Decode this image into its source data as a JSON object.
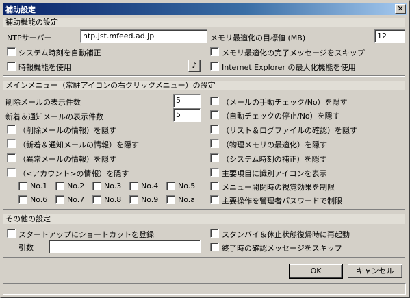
{
  "window": {
    "title": "補助設定",
    "close_glyph": "✕"
  },
  "aux": {
    "heading": "補助機能の設定",
    "ntp_label": "NTPサーバー",
    "ntp_value": "ntp.jst.mfeed.ad.jp",
    "mem_target_label": "メモリ最適化の目標値 (MB)",
    "mem_target_value": "12",
    "checks_left": [
      "システム時刻を自動補正",
      "時報機能を使用"
    ],
    "checks_right": [
      "メモリ最適化の完了メッセージをスキップ",
      "Internet Explorer の最大化機能を使用"
    ],
    "sound_glyph": "♪"
  },
  "menu": {
    "heading": "メインメニュー（常駐アイコンの右クリックメニュー）の設定",
    "del_count_label": "削除メールの表示件数",
    "del_count_value": "5",
    "new_count_label": "新着＆通知メールの表示件数",
    "new_count_value": "5",
    "checks_left": [
      "（削除メールの情報）を隠す",
      "（新着＆通知メールの情報）を隠す",
      "（異常メールの情報）を隠す",
      "（<アカウント>の情報）を隠す"
    ],
    "checks_right": [
      "（メールの手動チェック/No）を隠す",
      "（自動チェックの停止/No）を隠す",
      "（リスト＆ログファイルの確認）を隠す",
      "（物理メモリの最適化）を隠す",
      "（システム時刻の補正）を隠す",
      "主要項目に識別アイコンを表示",
      "メニュー開閉時の視覚効果を制限",
      "主要操作を管理者パスワードで制限"
    ],
    "accounts_row1": [
      "No.1",
      "No.2",
      "No.3",
      "No.4",
      "No.5"
    ],
    "accounts_row2": [
      "No.6",
      "No.7",
      "No.8",
      "No.9",
      "No.a"
    ]
  },
  "other": {
    "heading": "その他の設定",
    "startup_label": "スタートアップにショートカットを登録",
    "args_label": "引数",
    "args_value": "",
    "checks_right": [
      "スタンバイ＆休止状態復帰時に再起動",
      "終了時の確認メッセージをスキップ"
    ]
  },
  "buttons": {
    "ok": "OK",
    "cancel": "キャンセル"
  },
  "colors": {
    "title_start": "#0a246a",
    "title_end": "#a6caf0",
    "face": "#d4d0c8"
  }
}
